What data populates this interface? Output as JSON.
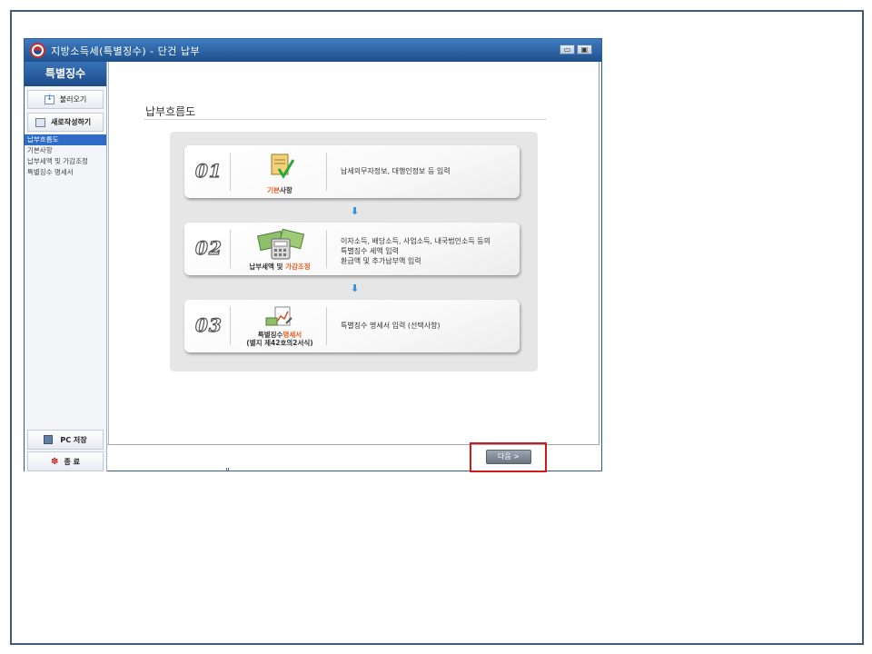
{
  "window": {
    "title": "지방소득세(특별징수) - 단건 납부",
    "minimize": "▭",
    "restore": "▣"
  },
  "sidebar": {
    "header": "특별징수",
    "load_button": "불러오기",
    "new_button": "새로작성하기",
    "items": [
      {
        "label": "납부흐름도",
        "active": true
      },
      {
        "label": "기본사항",
        "active": false
      },
      {
        "label": "납부세액 및 가감조정",
        "active": false
      },
      {
        "label": "특별징수 명세서",
        "active": false
      }
    ],
    "save_button": "PC 저장",
    "exit_button": "종 료"
  },
  "main": {
    "page_title": "납부흐름도",
    "steps": [
      {
        "number": "01",
        "caption_plain": "사항",
        "caption_highlight": "기본",
        "caption_second": "",
        "description": [
          "납세의무자정보, 대행인정보 등 입력"
        ]
      },
      {
        "number": "02",
        "caption_plain": "납부세액 및 ",
        "caption_highlight": "가감조정",
        "caption_second": "",
        "description": [
          "이자소득, 배당소득, 사업소득, 내국법인소득 등의",
          "특별징수 세액 입력",
          "환급액 및 추가납부액 입력"
        ]
      },
      {
        "number": "03",
        "caption_plain": "특별징수",
        "caption_highlight": "명세서",
        "caption_second": "(별지 제42호의2서식)",
        "description": [
          "특별징수 명세서 입력 (선택사항)"
        ]
      }
    ],
    "arrow": "➧"
  },
  "footer": {
    "next_button": "다음 >"
  },
  "colors": {
    "title_bar": "#1e4f8c",
    "accent_orange": "#ef5a1a",
    "highlight_red": "#d11a1a",
    "active_item": "#2f6cc5"
  }
}
